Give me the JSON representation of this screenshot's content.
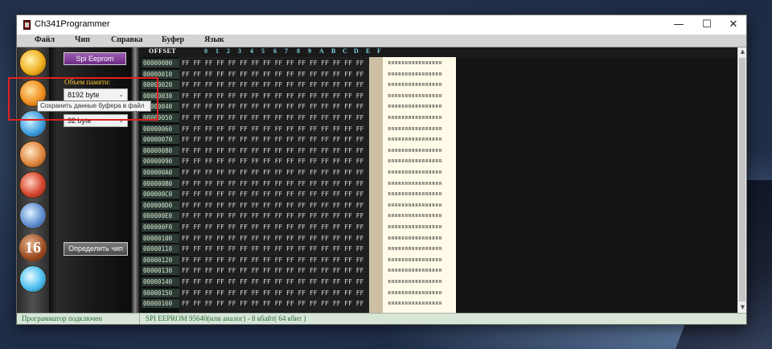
{
  "window": {
    "title": "Ch341Programmer",
    "minimize_glyph": "—",
    "maximize_glyph": "☐",
    "close_glyph": "✕"
  },
  "menu": [
    "Файл",
    "Чип",
    "Справка",
    "Буфер",
    "Язык"
  ],
  "toolbar": {
    "icons": [
      "read-chip-icon",
      "save-buffer-icon",
      "open-file-icon",
      "write-chip-icon",
      "erase-chip-icon",
      "verify-chip-icon",
      "hex-16-icon",
      "about-icon"
    ],
    "hex_label": "16"
  },
  "sidepanel": {
    "chip_button": "Spi Eeprom",
    "memory_label": "Объем памяти:",
    "memory_size": "8192 byte",
    "page_size": "32 byte",
    "detect_button": "Определить чип"
  },
  "tooltip": "Сохранить данные буфера в файл",
  "hex": {
    "header": "OFFSET",
    "columns": [
      "0",
      "1",
      "2",
      "3",
      "4",
      "5",
      "6",
      "7",
      "8",
      "9",
      "A",
      "B",
      "C",
      "D",
      "E",
      "F"
    ],
    "offsets": [
      "00000000",
      "00000010",
      "00000020",
      "00000030",
      "00000040",
      "00000050",
      "00000060",
      "00000070",
      "00000080",
      "00000090",
      "000000A0",
      "000000B0",
      "000000C0",
      "000000D0",
      "000000E0",
      "000000F0",
      "00000100",
      "00000110",
      "00000120",
      "00000130",
      "00000140",
      "00000150",
      "00000160"
    ],
    "row_bytes": "FF FF FF FF FF FF FF FF FF FF FF FF FF FF FF FF",
    "ascii_row": "яяяяяяяяяяяяяяяя"
  },
  "status": {
    "connection": "Программатор подключен",
    "chip_info": "SPI EEPROM   95640(или аналог)  -  8 кбайт(  64 кбит )"
  }
}
